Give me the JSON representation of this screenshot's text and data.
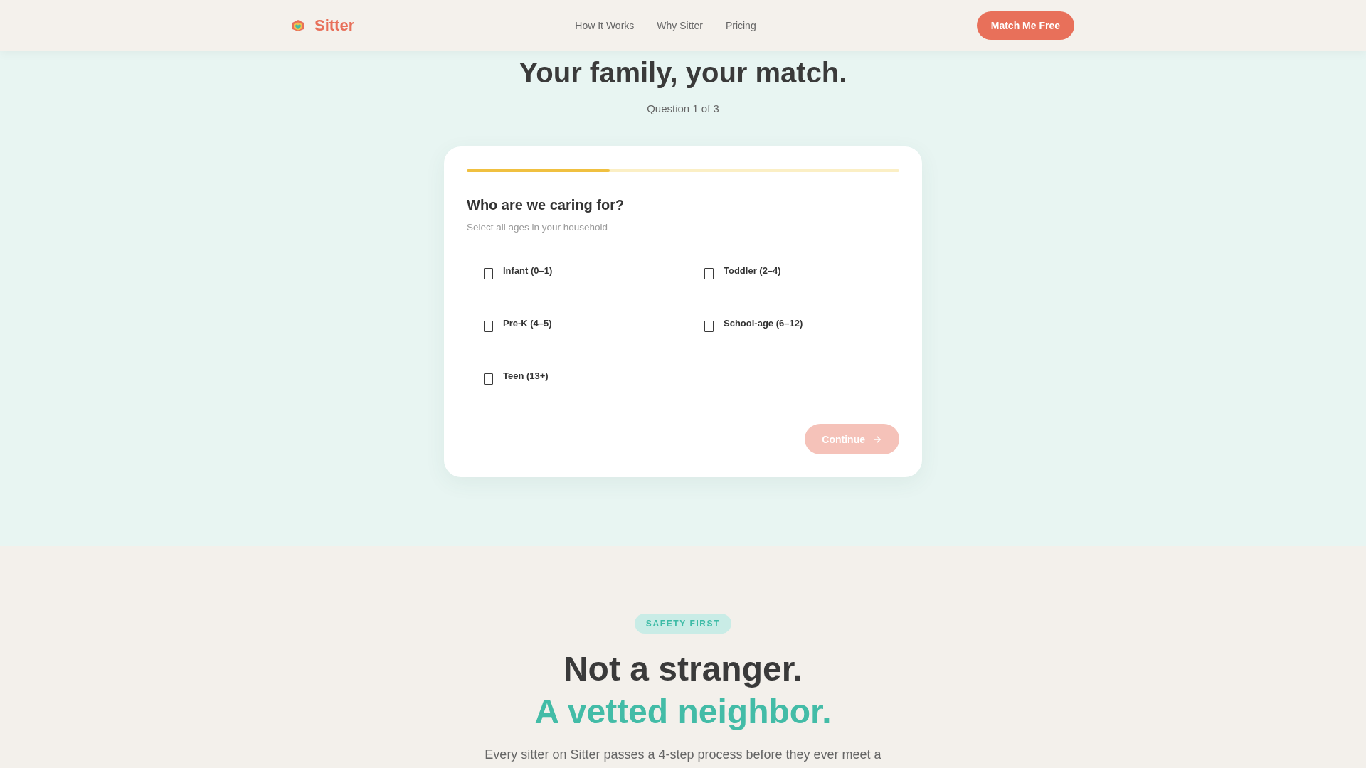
{
  "header": {
    "brand": "Sitter",
    "nav": [
      "How It Works",
      "Why Sitter",
      "Pricing"
    ],
    "cta": "Match Me Free"
  },
  "hero": {
    "title": "Your family, your match.",
    "step": "Question 1 of 3"
  },
  "quiz_card": {
    "progress": {
      "level": 0.33
    },
    "question": "Who are we caring for?",
    "hint": "Select all ages in your household",
    "options": [
      {
        "label": "Infant (0–1)",
        "checked": false
      },
      {
        "label": "Toddler (2–4)",
        "checked": false
      },
      {
        "label": "Pre-K (4–5)",
        "checked": false
      },
      {
        "label": "School-age (6–12)",
        "checked": false
      },
      {
        "label": "Teen (13+)",
        "checked": false
      }
    ],
    "continue_button": {
      "label": "Continue",
      "disabled": true
    }
  },
  "safety_section": {
    "badge": "SAFETY FIRST",
    "heading_line_1": "Not a stranger.",
    "heading_line_2": "A vetted neighbor.",
    "body": "Every sitter on Sitter passes a 4-step process before they ever meet a"
  }
}
